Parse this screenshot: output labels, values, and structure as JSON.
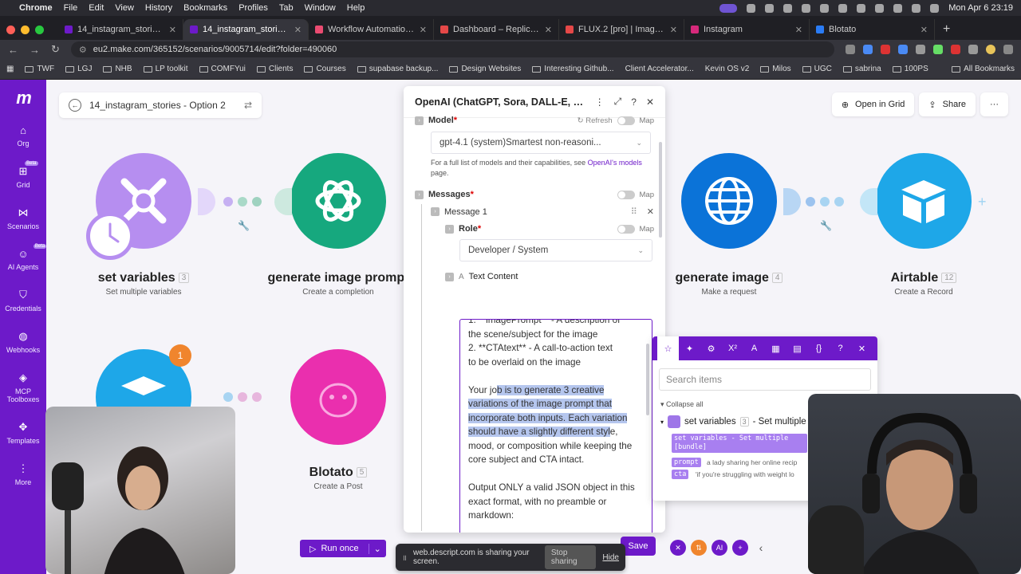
{
  "menubar": {
    "app": "Chrome",
    "items": [
      "File",
      "Edit",
      "View",
      "History",
      "Bookmarks",
      "Profiles",
      "Tab",
      "Window",
      "Help"
    ],
    "clock": "Mon Apr 6  23:19"
  },
  "tabs": [
    {
      "title": "14_instagram_stories - Optio",
      "favicon_color": "#6d1ac9"
    },
    {
      "title": "14_instagram_stories - Optio",
      "favicon_color": "#6d1ac9",
      "active": true
    },
    {
      "title": "Workflow Automation - n8n",
      "favicon_color": "#ea4b71"
    },
    {
      "title": "Dashboard – Replicate",
      "favicon_color": "#e54848"
    },
    {
      "title": "FLUX.2 [pro] | Image Generat",
      "favicon_color": "#e54848"
    },
    {
      "title": "Instagram",
      "favicon_color": "#d6297b"
    },
    {
      "title": "Blotato",
      "favicon_color": "#2a7cf6"
    }
  ],
  "address": {
    "url": "eu2.make.com/365152/scenarios/9005714/edit?folder=490060"
  },
  "bookmarks": [
    "TWF",
    "LGJ",
    "NHB",
    "LP toolkit",
    "COMFYui",
    "Clients",
    "Courses",
    "supabase backup...",
    "Design Websites",
    "Interesting Github...",
    "Client Accelerator...",
    "Kevin OS v2",
    "Milos",
    "UGC",
    "sabrina",
    "100PS",
    "All Bookmarks"
  ],
  "sidebar": {
    "items": [
      {
        "label": "Org",
        "icon": "home-icon"
      },
      {
        "label": "Grid",
        "icon": "grid-icon",
        "beta": "Beta"
      },
      {
        "label": "Scenarios",
        "icon": "share-icon"
      },
      {
        "label": "AI Agents",
        "icon": "robot-icon",
        "beta": "Beta"
      },
      {
        "label": "Credentials",
        "icon": "shield-icon"
      },
      {
        "label": "Webhooks",
        "icon": "globe-icon"
      },
      {
        "label": "MCP Toolboxes",
        "icon": "toolbox-icon"
      },
      {
        "label": "Templates",
        "icon": "puzzle-icon"
      },
      {
        "label": "More",
        "icon": "more-vertical-icon"
      }
    ]
  },
  "scenario": {
    "title": "14_instagram_stories - Option 2",
    "open_in_grid": "Open in Grid",
    "share": "Share",
    "run_once": "Run once",
    "save": "Save"
  },
  "nodes": [
    {
      "name": "set variables",
      "count": "3",
      "sub": "Set multiple variables",
      "color": "#b68ef0"
    },
    {
      "name": "generate image prompt",
      "sub": "Create a completion",
      "color": "#16a87e"
    },
    {
      "name": "generate image",
      "count": "4",
      "sub": "Make a request",
      "color": "#0b73d8"
    },
    {
      "name": "Airtable",
      "count": "12",
      "sub": "Create a Record",
      "color": "#1ea7e8"
    },
    {
      "name": "Blotato",
      "count": "5",
      "sub": "Create a Post",
      "color": "#ea2fae"
    },
    {
      "badge": "1"
    }
  ],
  "panel": {
    "title": "OpenAI (ChatGPT, Sora, DALL-E, W...",
    "model_label": "Model",
    "refresh": "Refresh",
    "map": "Map",
    "model_value": "gpt-4.1 (system)Smartest non-reasoni...",
    "model_help": "For a full list of models and their capabilities, see",
    "model_help_link": "OpenAI's models",
    "model_help_tail": "page.",
    "messages_label": "Messages",
    "message1": "Message 1",
    "role_label": "Role",
    "role_value": "Developer / System",
    "text_content_label": "Text Content",
    "text": {
      "l1": "1. **imagePrompt** - A description of",
      "l2": "the scene/subject for the image",
      "l3": "2. **CTAtext** - A call-to-action text",
      "l4": "to be overlaid on the image",
      "p2a": "Your jo",
      "p2hl": "b is to generate 3 creative variations of the image prompt that incorporate both inputs. Each variation should have a slightly different styl",
      "p2b": "e, mood, or composition while keeping the core subject and CTA intact.",
      "p3": "Output ONLY a valid JSON object in this exact format, with no preamble or markdown:"
    }
  },
  "picker": {
    "search_placeholder": "Search items",
    "collapse_all": "Collapse all",
    "module": "set variables",
    "module_count": "3",
    "module_tail": "- Set multiple",
    "bundle": "set variables - Set multiple [bundle]",
    "items": [
      {
        "key": "prompt",
        "value": "a lady sharing her online recip"
      },
      {
        "key": "cta",
        "value": "'if you're struggling with weight lo"
      }
    ]
  },
  "share_bar": {
    "text": "web.descript.com is sharing your screen.",
    "stop": "Stop sharing",
    "hide": "Hide"
  }
}
